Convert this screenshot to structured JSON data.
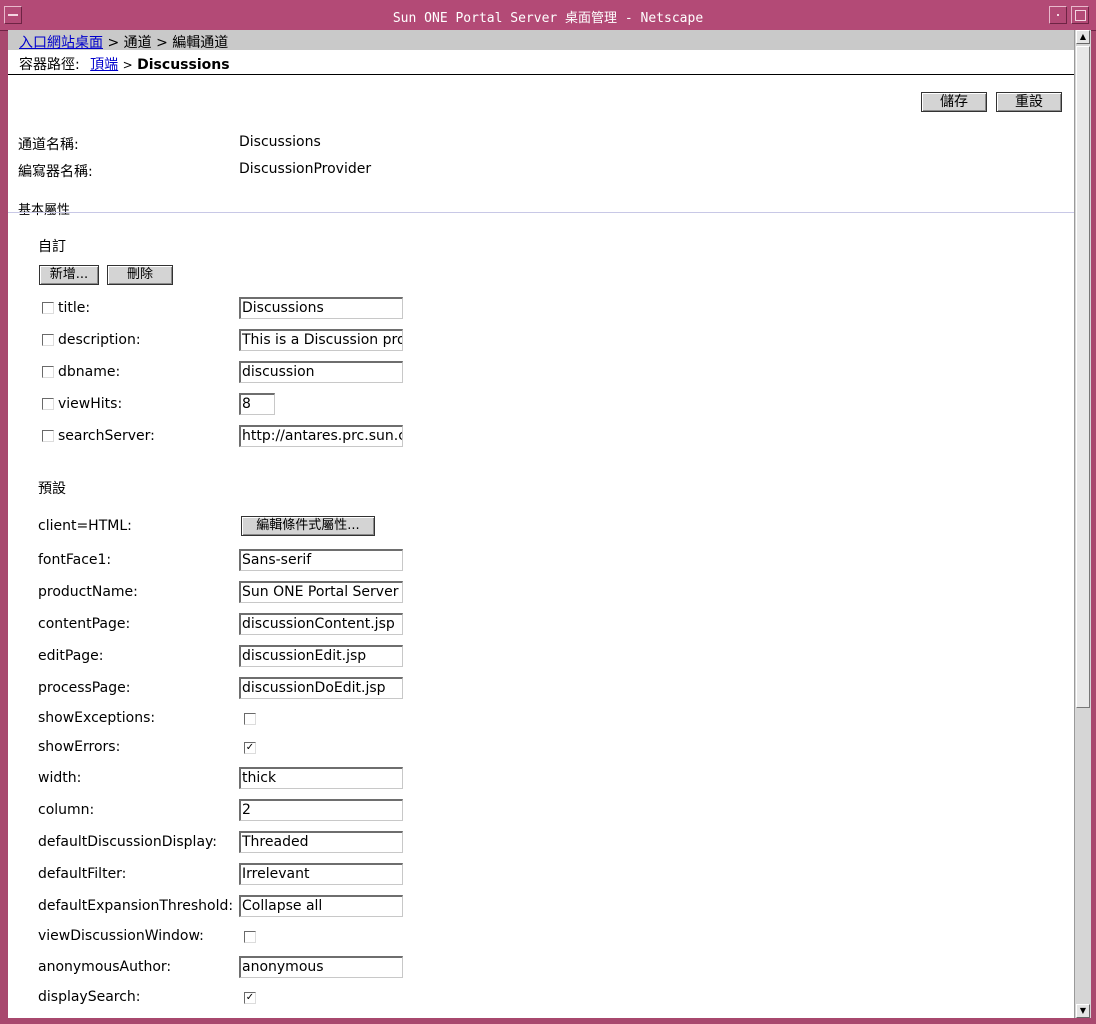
{
  "window": {
    "title": "Sun ONE Portal Server 桌面管理 - Netscape"
  },
  "breadcrumb": {
    "home_link": "入口網站桌面",
    "rest": "> 通道 > 編輯通道"
  },
  "container_path": {
    "label": "容器路徑:",
    "top_link": "頂端",
    "sep": ">",
    "current": "Discussions"
  },
  "actions": {
    "save": "儲存",
    "reset": "重設"
  },
  "channel": {
    "name_label": "通道名稱:",
    "name_value": "Discussions",
    "provider_label": "編寫器名稱:",
    "provider_value": "DiscussionProvider"
  },
  "basic_properties": {
    "heading": "基本屬性"
  },
  "custom": {
    "heading": "自訂",
    "add_button": "新增...",
    "delete_button": "刪除",
    "rows": [
      {
        "label": "title:",
        "value": "Discussions"
      },
      {
        "label": "description:",
        "value": "This is a Discussion provider"
      },
      {
        "label": "dbname:",
        "value": "discussion"
      },
      {
        "label": "viewHits:",
        "value": "8"
      },
      {
        "label": "searchServer:",
        "value": "http://antares.prc.sun.com"
      }
    ]
  },
  "defaults": {
    "heading": "預設",
    "client_label": "client=HTML:",
    "client_button": "編輯條件式屬性...",
    "fontFace1": {
      "label": "fontFace1:",
      "value": "Sans-serif"
    },
    "productName": {
      "label": "productName:",
      "value": "Sun ONE Portal Server"
    },
    "contentPage": {
      "label": "contentPage:",
      "value": "discussionContent.jsp"
    },
    "editPage": {
      "label": "editPage:",
      "value": "discussionEdit.jsp"
    },
    "processPage": {
      "label": "processPage:",
      "value": "discussionDoEdit.jsp"
    },
    "showExceptions": {
      "label": "showExceptions:",
      "checked": false
    },
    "showErrors": {
      "label": "showErrors:",
      "checked": true
    },
    "width": {
      "label": "width:",
      "value": "thick"
    },
    "column": {
      "label": "column:",
      "value": "2"
    },
    "defaultDiscussionDisplay": {
      "label": "defaultDiscussionDisplay:",
      "value": "Threaded"
    },
    "defaultFilter": {
      "label": "defaultFilter:",
      "value": "Irrelevant"
    },
    "defaultExpansionThreshold": {
      "label": "defaultExpansionThreshold:",
      "value": "Collapse all"
    },
    "viewDiscussionWindow": {
      "label": "viewDiscussionWindow:",
      "checked": false
    },
    "anonymousAuthor": {
      "label": "anonymousAuthor:",
      "value": "anonymous"
    },
    "displaySearch": {
      "label": "displaySearch:",
      "checked": true
    }
  },
  "colors": {
    "frame": "#b34a76",
    "link": "#0000cc",
    "nav_strip": "#c9c9c9"
  },
  "icons": {
    "checked_mark": "check-icon",
    "scroll_up": "arrow-up-icon",
    "scroll_down": "arrow-down-icon"
  }
}
